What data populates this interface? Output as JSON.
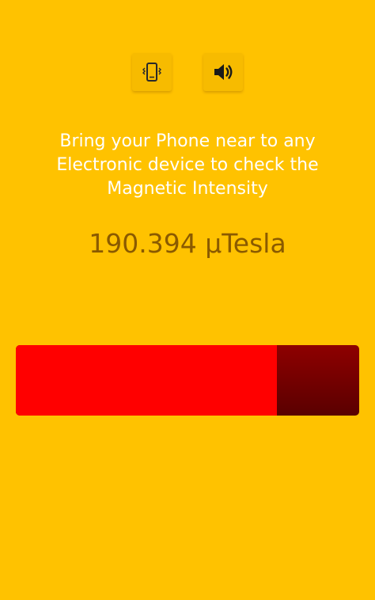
{
  "toolbar": {
    "vibrate_icon": "phone-vibrate-icon",
    "sound_icon": "speaker-icon"
  },
  "message": "Bring your Phone near to any\nElectronic device to check the\nMagnetic Intensity",
  "reading": "190.394 µTesla",
  "meter": {
    "fraction": 0.76,
    "fill_color": "#FF0000",
    "track_color": "#6E0000"
  },
  "colors": {
    "background": "#FFC200",
    "button": "#F7BB00",
    "message_text": "#FFFFFF",
    "reading_text": "#8A5A00"
  }
}
